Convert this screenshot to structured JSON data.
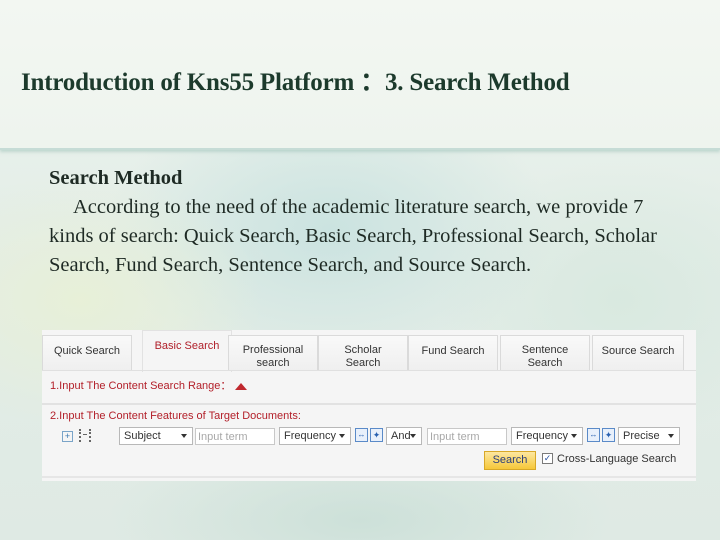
{
  "slide": {
    "title": "Introduction of Kns55 Platform ：3. Search Method",
    "heading": "Search Method",
    "paragraph": "According to the need of the academic literature search, we provide 7 kinds of search: Quick Search, Basic Search, Professional Search, Scholar Search, Fund Search, Sentence Search, and Source Search."
  },
  "search_ui": {
    "tabs": [
      {
        "label": "Quick Search",
        "active": false
      },
      {
        "label": "Basic Search",
        "active": true
      },
      {
        "label": "Professional search",
        "active": false
      },
      {
        "label": "Scholar Search",
        "active": false
      },
      {
        "label": "Fund Search",
        "active": false
      },
      {
        "label": "Sentence Search",
        "active": false
      },
      {
        "label": "Source Search",
        "active": false
      }
    ],
    "range_label": "1.Input The Content Search Range：",
    "features_label": "2.Input The Content Features of Target Documents:",
    "field_select": "Subject",
    "term1_placeholder": "Input term",
    "freq1_select": "Frequency",
    "logic_select": "And",
    "term2_placeholder": "Input term",
    "freq2_select": "Frequency",
    "match_select": "Precise",
    "search_button": "Search",
    "cross_language_label": "Cross-Language Search",
    "cross_language_checked": true,
    "icons": {
      "plus": "+",
      "frequency": "↔",
      "expand": "✦",
      "check": "✓"
    },
    "colors": {
      "accent_red": "#b3202a",
      "search_button": "#f6c83a"
    }
  }
}
